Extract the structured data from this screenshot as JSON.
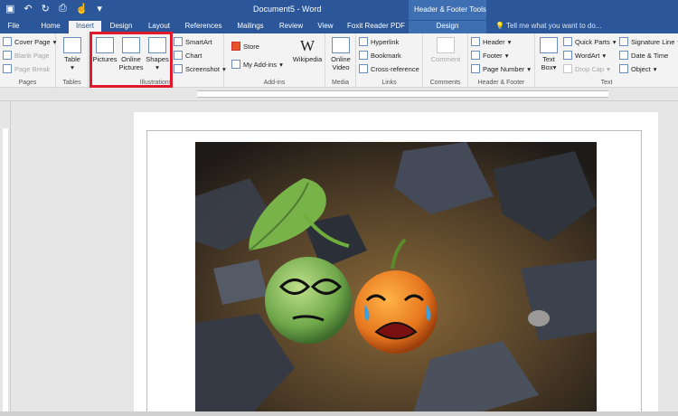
{
  "window": {
    "title": "Document5 - Word",
    "contextual_tools_title": "Header & Footer Tools"
  },
  "tabs": [
    {
      "label": "File"
    },
    {
      "label": "Home"
    },
    {
      "label": "Insert"
    },
    {
      "label": "Design"
    },
    {
      "label": "Layout"
    },
    {
      "label": "References"
    },
    {
      "label": "Mailings"
    },
    {
      "label": "Review"
    },
    {
      "label": "View"
    },
    {
      "label": "Foxit Reader PDF"
    },
    {
      "label": "Design"
    }
  ],
  "active_tab": "Insert",
  "tell_me": {
    "placeholder": "Tell me what you want to do..."
  },
  "ribbon": {
    "pages": {
      "label": "Pages",
      "cover_page": "Cover Page",
      "blank_page": "Blank Page",
      "page_break": "Page Break"
    },
    "tables": {
      "label": "Tables",
      "table": "Table"
    },
    "illustrations": {
      "label": "Illustrations",
      "pictures": "Pictures",
      "online_pictures_1": "Online",
      "online_pictures_2": "Pictures",
      "shapes": "Shapes",
      "smartart": "SmartArt",
      "chart": "Chart",
      "screenshot": "Screenshot"
    },
    "addins": {
      "label": "Add-ins",
      "store": "Store",
      "my_addins": "My Add-ins",
      "wikipedia": "Wikipedia"
    },
    "media": {
      "label": "Media",
      "online_video_1": "Online",
      "online_video_2": "Video"
    },
    "links": {
      "label": "Links",
      "hyperlink": "Hyperlink",
      "bookmark": "Bookmark",
      "cross_reference": "Cross-reference"
    },
    "comments": {
      "label": "Comments",
      "comment": "Comment"
    },
    "header_footer": {
      "label": "Header & Footer",
      "header": "Header",
      "footer": "Footer",
      "page_number": "Page Number"
    },
    "text": {
      "label": "Text",
      "text_box_1": "Text",
      "text_box_2": "Box",
      "quick_parts": "Quick Parts",
      "wordart": "WordArt",
      "drop_cap": "Drop Cap",
      "signature_line": "Signature Line",
      "date_time": "Date & Time",
      "object": "Object"
    }
  },
  "colors": {
    "title_bar": "#2b579a",
    "highlight": "#e0192b"
  }
}
